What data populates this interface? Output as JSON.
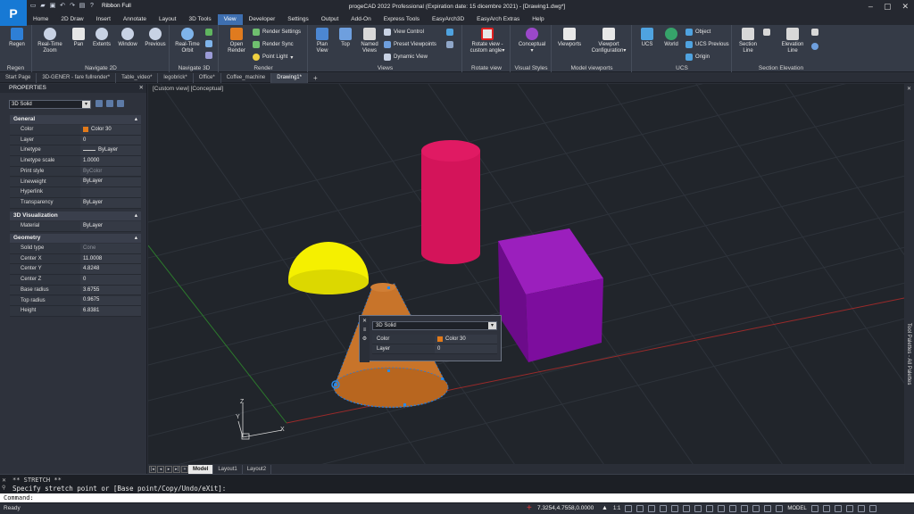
{
  "titlebar": {
    "logo_letter": "P",
    "ribbon_mode": "Ribbon Full",
    "title": "progeCAD 2022 Professional  (Expiration date: 15 dicembre 2021) - [Drawing1.dwg*]"
  },
  "menu_tabs": [
    "Home",
    "2D Draw",
    "Insert",
    "Annotate",
    "Layout",
    "3D Tools",
    "View",
    "Developer",
    "Settings",
    "Output",
    "Add-On",
    "Express Tools",
    "EasyArch3D",
    "EasyArch Extras",
    "Help"
  ],
  "active_menu_tab": "View",
  "ribbon": {
    "groups": {
      "regen": "Regen",
      "navigate2d": "Navigate 2D",
      "navigate3d": "Navigate 3D",
      "render": "Render",
      "views": "Views",
      "rotate_view": "Rotate view",
      "visual_styles": "Visual Styles",
      "model_viewports": "Model viewports",
      "ucs": "UCS",
      "section_elevation": "Section  Elevation"
    },
    "buttons": {
      "regen": "Regen",
      "realtime_zoom_1": "Real-Time",
      "realtime_zoom_2": "Zoom",
      "pan": "Pan",
      "extents": "Extents",
      "window": "Window",
      "previous": "Previous",
      "orbit_1": "Real-Time",
      "orbit_2": "Orbit",
      "open_render_1": "Open",
      "open_render_2": "Render",
      "render_settings": "Render Settings",
      "render_sync": "Render Sync",
      "point_light": "Point Light",
      "plan_view_1": "Plan",
      "plan_view_2": "View",
      "top": "Top",
      "named_views_1": "Named",
      "named_views_2": "Views",
      "view_control": "View Control",
      "preset_viewpoints": "Preset Viewpoints",
      "dynamic_view": "Dynamic View",
      "rotate_view_1": "Rotate view -",
      "rotate_view_2": "custom angle",
      "conceptual": "Conceptual",
      "viewports": "Viewports",
      "viewport_config_1": "Viewport",
      "viewport_config_2": "Configuration",
      "ucs": "UCS",
      "world": "World",
      "object": "Object",
      "ucs_previous": "UCS Previous",
      "origin": "Origin",
      "section_line_1": "Section",
      "section_line_2": "Line",
      "elevation_line_1": "Elevation",
      "elevation_line_2": "Line"
    }
  },
  "doc_tabs": [
    "Start Page",
    "3D-GENER - fare fullrender*",
    "Table_video*",
    "legobrick*",
    "Office*",
    "Coffee_machine",
    "Drawing1*"
  ],
  "active_doc_tab": "Drawing1*",
  "properties": {
    "title": "PROPERTIES",
    "selection": "3D Solid",
    "sections": {
      "general": "General",
      "visualization": "3D Visualization",
      "geometry": "Geometry"
    },
    "general": [
      {
        "k": "Color",
        "v": "Color 30"
      },
      {
        "k": "Layer",
        "v": "0"
      },
      {
        "k": "Linetype",
        "v": "ByLayer"
      },
      {
        "k": "Linetype scale",
        "v": "1.0000"
      },
      {
        "k": "Print style",
        "v": "ByColor"
      },
      {
        "k": "Lineweight",
        "v": "ByLayer"
      },
      {
        "k": "Hyperlink",
        "v": ""
      },
      {
        "k": "Transparency",
        "v": "ByLayer"
      }
    ],
    "visualization": [
      {
        "k": "Material",
        "v": "ByLayer"
      }
    ],
    "geometry": [
      {
        "k": "Solid type",
        "v": "Cone"
      },
      {
        "k": "Center X",
        "v": "11.0008"
      },
      {
        "k": "Center Y",
        "v": "4.8248"
      },
      {
        "k": "Center Z",
        "v": "0"
      },
      {
        "k": "Base radius",
        "v": "3.6755"
      },
      {
        "k": "Top radius",
        "v": "0.9675"
      },
      {
        "k": "Height",
        "v": "6.8381"
      }
    ]
  },
  "viewport": {
    "label": "[Custom view] [Conceptual]",
    "axis_x": "X",
    "axis_y": "Y",
    "axis_z": "Z"
  },
  "quick_props": {
    "selection": "3D Solid",
    "rows": [
      {
        "k": "Color",
        "v": "Color 30"
      },
      {
        "k": "Layer",
        "v": "0"
      }
    ]
  },
  "right_strip": "Tool Palettes - All Palettes",
  "layout_tabs": [
    "Model",
    "Layout1",
    "Layout2"
  ],
  "command": {
    "line1": "** STRETCH **",
    "line2": "Specify stretch point or [Base point/Copy/Undo/eXit]:",
    "line3": "Command:"
  },
  "status": {
    "ready": "Ready",
    "coords": "7.3254,4.7558,0.0000",
    "scale": "1:1",
    "model": "MODEL"
  },
  "colors": {
    "accent": "#3e6fb0",
    "cylinder": "#d4145a",
    "box": "#7a0a9a",
    "hemisphere": "#f5f000",
    "cone": "#c8742a"
  }
}
